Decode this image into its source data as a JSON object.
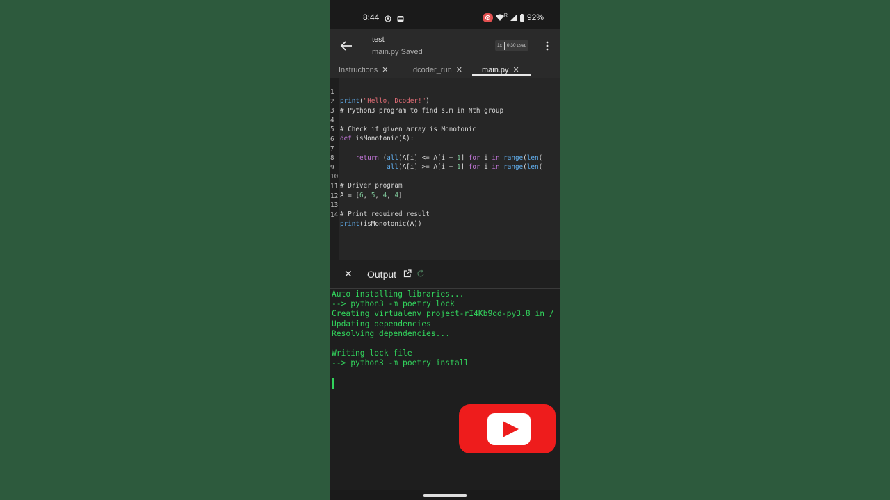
{
  "status_bar": {
    "time": "8:44",
    "battery": "92%",
    "signal_label": "R"
  },
  "app_bar": {
    "title": "test",
    "subtitle": "main.py",
    "save_status": "Saved",
    "speed": "1x",
    "usage": "0.30 used"
  },
  "tabs": [
    {
      "label": "Instructions",
      "active": false
    },
    {
      "label": ".dcoder_run",
      "active": false
    },
    {
      "label": "main.py",
      "active": true
    }
  ],
  "editor": {
    "lines": [
      "1",
      "2",
      "3",
      "4",
      "5",
      "6",
      "7",
      "8",
      "9",
      "10",
      "11",
      "12",
      "13",
      "14"
    ],
    "code": [
      "print(\"Hello, Dcoder!\")",
      "# Python3 program to find sum in Nth group",
      "",
      "# Check if given array is Monotonic",
      "def isMonotonic(A):",
      "",
      "    return (all(A[i] <= A[i + 1] for i in range(len(",
      "            all(A[i] >= A[i + 1] for i in range(len(",
      "",
      "# Driver program",
      "A = [6, 5, 4, 4]",
      "",
      "# Print required result",
      "print(isMonotonic(A))"
    ]
  },
  "output": {
    "title": "Output",
    "console_lines": [
      "Auto installing libraries...",
      "--> python3 -m poetry lock",
      "Creating virtualenv project-rI4Kb9qd-py3.8 in /",
      "Updating dependencies",
      "Resolving dependencies...",
      "",
      "Writing lock file",
      "--> python3 -m poetry install"
    ]
  },
  "colors": {
    "background": "#2d5a3d",
    "console_text": "#32d35c",
    "youtube_red": "#ee1c1c"
  }
}
